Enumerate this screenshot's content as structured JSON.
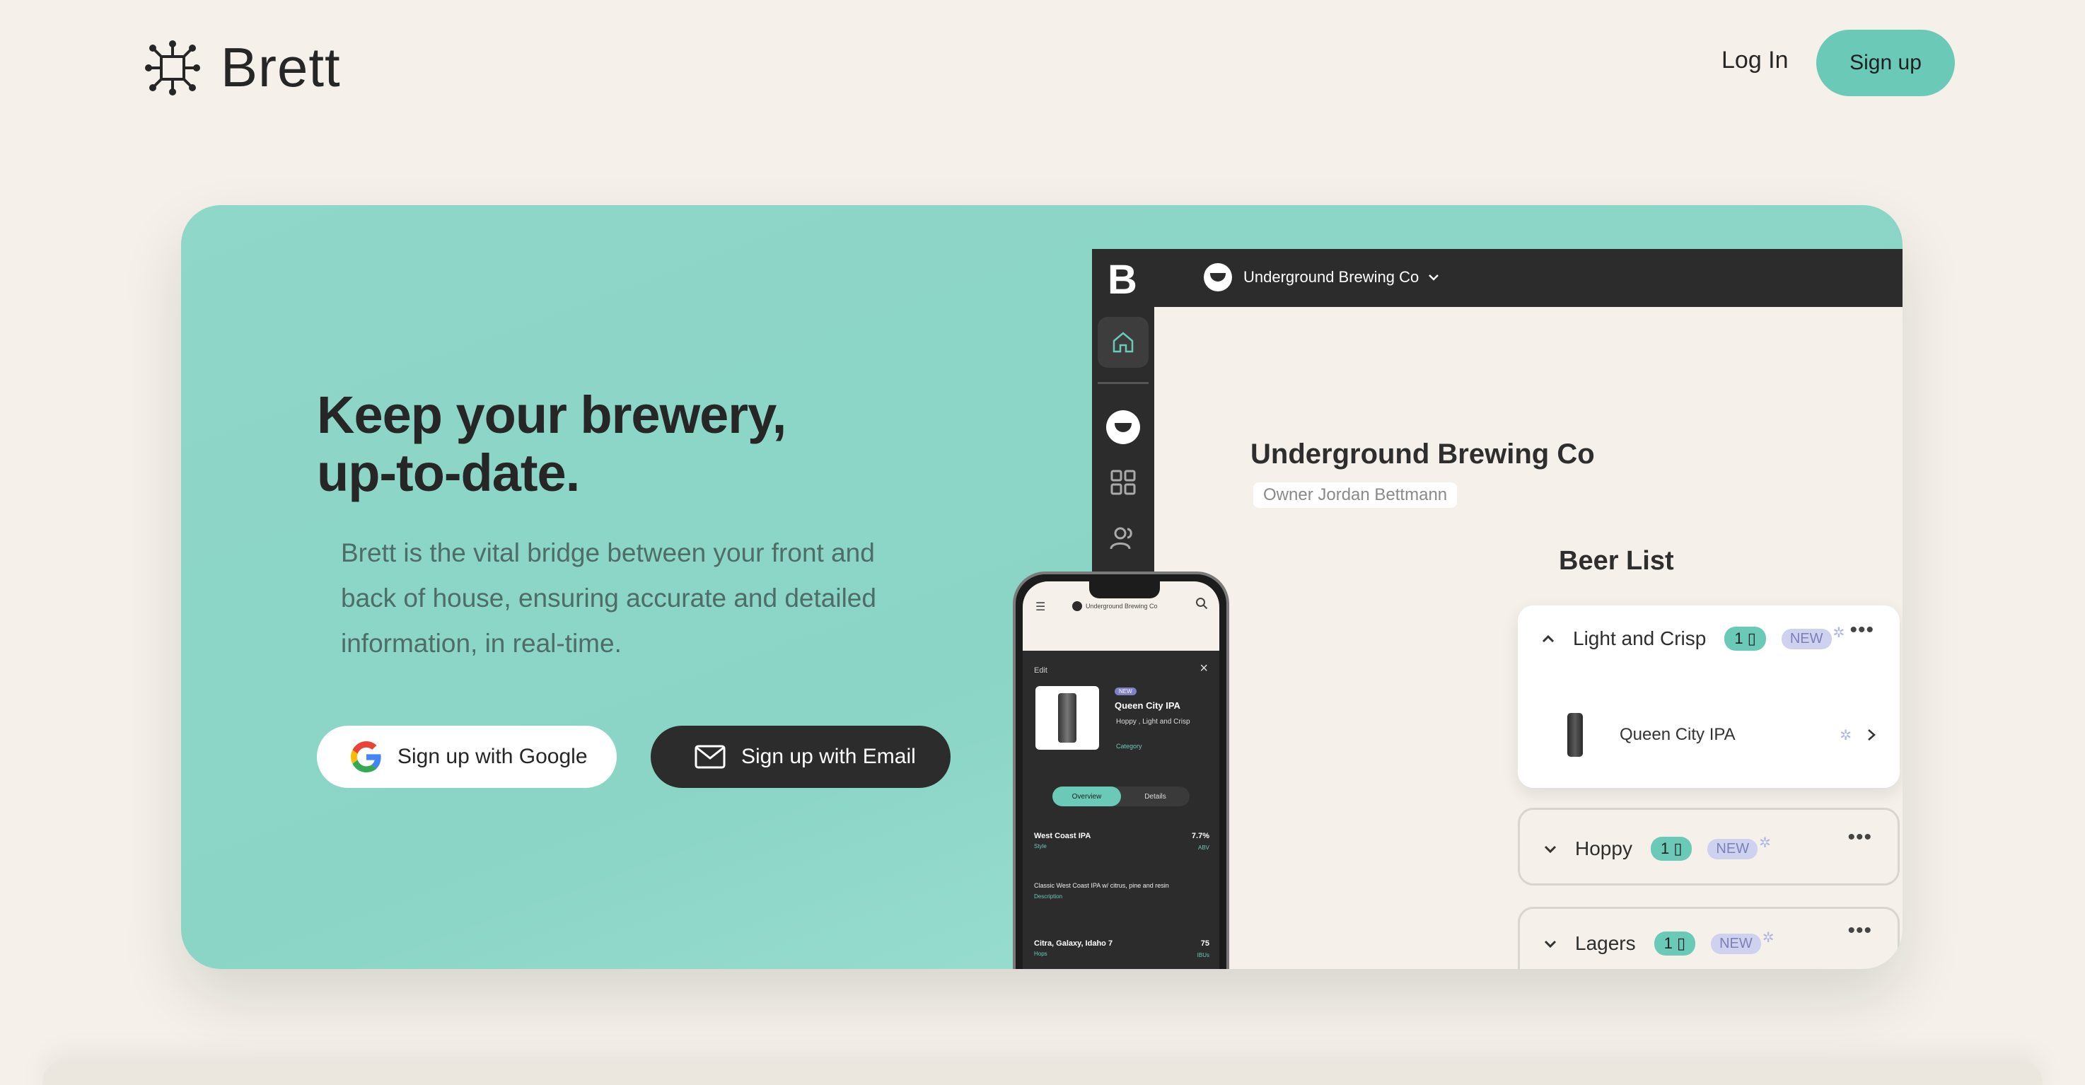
{
  "header": {
    "logo_text": "Brett",
    "login_label": "Log In",
    "signup_label": "Sign up"
  },
  "hero": {
    "title_line1": "Keep your brewery,",
    "title_line2": "up-to-date.",
    "description": "Brett is the vital bridge between your front and back of house, ensuring accurate and detailed information, in real-time.",
    "google_button": "Sign up with Google",
    "email_button": "Sign up with Email"
  },
  "desktop_app": {
    "app_letter": "B",
    "brewery_selector": "Underground Brewing Co",
    "brewery_title": "Underground Brewing Co",
    "owner": "Owner Jordan Bettmann",
    "beer_list_title": "Beer List",
    "groups": [
      {
        "name": "Light and Crisp",
        "count": "1",
        "badge": "NEW",
        "expanded": true,
        "items": [
          "Queen City IPA"
        ]
      },
      {
        "name": "Hoppy",
        "count": "1",
        "badge": "NEW",
        "expanded": false
      },
      {
        "name": "Lagers",
        "count": "1",
        "badge": "NEW",
        "expanded": false
      }
    ]
  },
  "phone_app": {
    "brand": "Underground Brewing Co",
    "edit_label": "Edit",
    "badge": "NEW",
    "beer_name": "Queen City IPA",
    "categories": "Hoppy , Light and Crisp",
    "category_label": "Category",
    "tabs": [
      "Overview",
      "Details"
    ],
    "style_value": "West Coast IPA",
    "style_label": "Style",
    "abv_value": "7.7%",
    "abv_label": "ABV",
    "description_value": "Classic West Coast IPA w/ citrus, pine and resin",
    "description_label": "Description",
    "hops_value": "Citra, Galaxy, Idaho 7",
    "hops_label": "Hops",
    "ibu_value": "75",
    "ibu_label": "IBUs"
  },
  "colors": {
    "background": "#f5f1ea",
    "accent": "#6bc9b8",
    "hero": "#8fd7c8",
    "dark": "#2c2c2c",
    "new_badge": "#cfd2ef"
  },
  "icons": {
    "logo": "network-node-icon",
    "google": "google-g-icon",
    "email": "envelope-icon",
    "home": "home-icon",
    "grid": "grid-icon",
    "users": "users-icon",
    "chevron": "chevron-down-icon",
    "more": "more-dots-icon",
    "sparkle": "sparkle-icon"
  }
}
